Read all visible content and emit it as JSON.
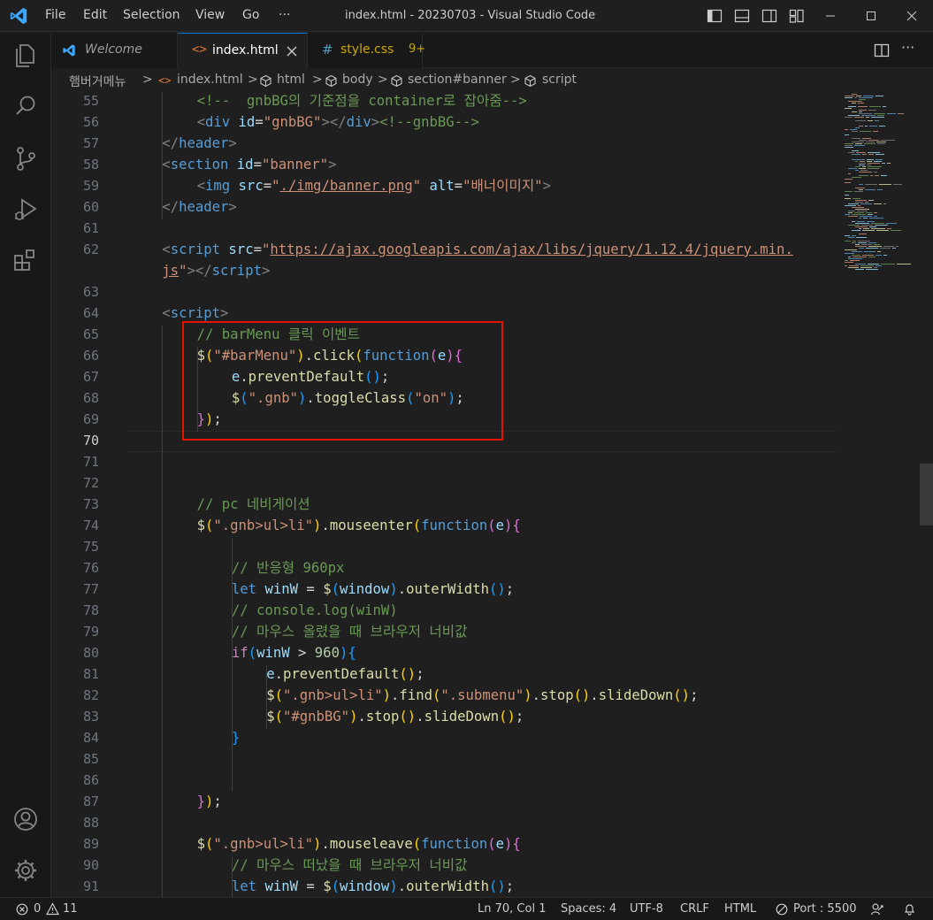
{
  "titlebar": {
    "menus": [
      "File",
      "Edit",
      "Selection",
      "View",
      "Go",
      "···"
    ],
    "title": "index.html - 20230703 - Visual Studio Code"
  },
  "tabs": [
    {
      "label": "Welcome",
      "icon": "vscode-icon"
    },
    {
      "label": "index.html",
      "icon": "html-icon",
      "active": true
    },
    {
      "label": "style.css",
      "badge": "9+",
      "icon": "css-icon"
    }
  ],
  "breadcrumb": {
    "items": [
      "햄버거메뉴",
      "index.html",
      "html",
      "body",
      "section#banner",
      "script"
    ],
    "separator": ">"
  },
  "editor": {
    "current_line": "70",
    "lines": [
      {
        "n": "55",
        "indent": 2,
        "segs": [
          [
            "t-com",
            "<!--  gnbBG의 기준점을 container로 잡아줌-->"
          ]
        ]
      },
      {
        "n": "56",
        "indent": 2,
        "segs": [
          [
            "t-br",
            "<"
          ],
          [
            "t-tag",
            "div"
          ],
          [
            "",
            " "
          ],
          [
            "t-attr",
            "id"
          ],
          [
            "",
            "="
          ],
          [
            "t-str",
            "\"gnbBG\""
          ],
          [
            "t-br",
            "></"
          ],
          [
            "t-tag",
            "div"
          ],
          [
            "t-br",
            ">"
          ],
          [
            "t-com",
            "<!--gnbBG-->"
          ]
        ]
      },
      {
        "n": "57",
        "indent": 1,
        "segs": [
          [
            "t-br",
            "</"
          ],
          [
            "t-tag",
            "header"
          ],
          [
            "t-br",
            ">"
          ]
        ]
      },
      {
        "n": "58",
        "indent": 1,
        "segs": [
          [
            "t-br",
            "<"
          ],
          [
            "t-tag",
            "section"
          ],
          [
            "",
            " "
          ],
          [
            "t-attr",
            "id"
          ],
          [
            "",
            "="
          ],
          [
            "t-str",
            "\"banner\""
          ],
          [
            "t-br",
            ">"
          ]
        ]
      },
      {
        "n": "59",
        "indent": 2,
        "segs": [
          [
            "t-br",
            "<"
          ],
          [
            "t-tag",
            "img"
          ],
          [
            "",
            " "
          ],
          [
            "t-attr",
            "src"
          ],
          [
            "",
            "="
          ],
          [
            "t-str",
            "\""
          ],
          [
            "t-link",
            "./img/banner.png"
          ],
          [
            "t-str",
            "\""
          ],
          [
            "",
            " "
          ],
          [
            "t-attr",
            "alt"
          ],
          [
            "",
            "="
          ],
          [
            "t-str",
            "\"배너이미지\""
          ],
          [
            "t-br",
            ">"
          ]
        ]
      },
      {
        "n": "60",
        "indent": 1,
        "segs": [
          [
            "t-br",
            "</"
          ],
          [
            "t-tag",
            "header"
          ],
          [
            "t-br",
            ">"
          ]
        ]
      },
      {
        "n": "61",
        "indent": 0,
        "segs": []
      },
      {
        "n": "62",
        "indent": 1,
        "segs": [
          [
            "t-br",
            "<"
          ],
          [
            "t-tag",
            "script"
          ],
          [
            "",
            " "
          ],
          [
            "t-attr",
            "src"
          ],
          [
            "",
            "="
          ],
          [
            "t-str",
            "\""
          ],
          [
            "t-link",
            "https://ajax.googleapis.com/ajax/libs/jquery/1.12.4/jquery.min."
          ]
        ]
      },
      {
        "n": "",
        "indent": 1,
        "segs": [
          [
            "t-link",
            "js"
          ],
          [
            "t-str",
            "\""
          ],
          [
            "t-br",
            "></"
          ],
          [
            "t-tag",
            "script"
          ],
          [
            "t-br",
            ">"
          ]
        ]
      },
      {
        "n": "63",
        "indent": 0,
        "segs": []
      },
      {
        "n": "64",
        "indent": 1,
        "segs": [
          [
            "t-br",
            "<"
          ],
          [
            "t-tag",
            "script"
          ],
          [
            "t-br",
            ">"
          ]
        ]
      },
      {
        "n": "65",
        "indent": 2,
        "segs": [
          [
            "t-com",
            "// barMenu 클릭 이벤트"
          ]
        ]
      },
      {
        "n": "66",
        "indent": 2,
        "segs": [
          [
            "t-fn",
            "$"
          ],
          [
            "t-p1",
            "("
          ],
          [
            "t-str",
            "\"#barMenu\""
          ],
          [
            "t-p1",
            ")"
          ],
          [
            "",
            "."
          ],
          [
            "t-fn",
            "click"
          ],
          [
            "t-p1",
            "("
          ],
          [
            "t-kw",
            "function"
          ],
          [
            "t-p2",
            "("
          ],
          [
            "t-var",
            "e"
          ],
          [
            "t-p2",
            ")"
          ],
          [
            "t-p2",
            "{"
          ]
        ]
      },
      {
        "n": "67",
        "indent": 3,
        "segs": [
          [
            "t-var",
            "e"
          ],
          [
            "",
            "."
          ],
          [
            "t-fn",
            "preventDefault"
          ],
          [
            "t-p3",
            "()"
          ],
          [
            ";",
            ";"
          ]
        ]
      },
      {
        "n": "68",
        "indent": 3,
        "segs": [
          [
            "t-fn",
            "$"
          ],
          [
            "t-p3",
            "("
          ],
          [
            "t-str",
            "\".gnb\""
          ],
          [
            "t-p3",
            ")"
          ],
          [
            "",
            "."
          ],
          [
            "t-fn",
            "toggleClass"
          ],
          [
            "t-p3",
            "("
          ],
          [
            "t-str",
            "\"on\""
          ],
          [
            "t-p3",
            ")"
          ],
          [
            "",
            ";"
          ]
        ]
      },
      {
        "n": "69",
        "indent": 2,
        "segs": [
          [
            "t-p2",
            "}"
          ],
          [
            "t-p1",
            ")"
          ],
          [
            "",
            ";"
          ]
        ]
      },
      {
        "n": "70",
        "indent": 0,
        "segs": []
      },
      {
        "n": "71",
        "indent": 0,
        "segs": []
      },
      {
        "n": "72",
        "indent": 0,
        "segs": []
      },
      {
        "n": "73",
        "indent": 2,
        "segs": [
          [
            "t-com",
            "// pc 네비게이션"
          ]
        ]
      },
      {
        "n": "74",
        "indent": 2,
        "segs": [
          [
            "t-fn",
            "$"
          ],
          [
            "t-p1",
            "("
          ],
          [
            "t-str",
            "\".gnb>ul>li\""
          ],
          [
            "t-p1",
            ")"
          ],
          [
            "",
            "."
          ],
          [
            "t-fn",
            "mouseenter"
          ],
          [
            "t-p1",
            "("
          ],
          [
            "t-kw",
            "function"
          ],
          [
            "t-p2",
            "("
          ],
          [
            "t-var",
            "e"
          ],
          [
            "t-p2",
            ")"
          ],
          [
            "t-p2",
            "{"
          ]
        ]
      },
      {
        "n": "75",
        "indent": 0,
        "segs": []
      },
      {
        "n": "76",
        "indent": 3,
        "segs": [
          [
            "t-com",
            "// 반응형 960px"
          ]
        ]
      },
      {
        "n": "77",
        "indent": 3,
        "segs": [
          [
            "t-kw",
            "let"
          ],
          [
            "",
            " "
          ],
          [
            "t-var",
            "winW"
          ],
          [
            "",
            " = "
          ],
          [
            "t-fn",
            "$"
          ],
          [
            "t-p3",
            "("
          ],
          [
            "t-var",
            "window"
          ],
          [
            "t-p3",
            ")"
          ],
          [
            "",
            "."
          ],
          [
            "t-fn",
            "outerWidth"
          ],
          [
            "t-p3",
            "()"
          ],
          [
            "",
            ";"
          ]
        ]
      },
      {
        "n": "78",
        "indent": 3,
        "segs": [
          [
            "t-com",
            "// console.log(winW)"
          ]
        ]
      },
      {
        "n": "79",
        "indent": 3,
        "segs": [
          [
            "t-com",
            "// 마우스 올렸을 때 브라우저 너비값"
          ]
        ]
      },
      {
        "n": "80",
        "indent": 3,
        "segs": [
          [
            "t-ctrl",
            "if"
          ],
          [
            "t-p3",
            "("
          ],
          [
            "t-var",
            "winW"
          ],
          [
            "",
            " > "
          ],
          [
            "t-num",
            "960"
          ],
          [
            "t-p3",
            ")"
          ],
          [
            "t-p3",
            "{"
          ]
        ]
      },
      {
        "n": "81",
        "indent": 4,
        "segs": [
          [
            "t-var",
            "e"
          ],
          [
            "",
            "."
          ],
          [
            "t-fn",
            "preventDefault"
          ],
          [
            "t-p1",
            "()"
          ],
          [
            "",
            ";"
          ]
        ]
      },
      {
        "n": "82",
        "indent": 4,
        "segs": [
          [
            "t-fn",
            "$"
          ],
          [
            "t-p1",
            "("
          ],
          [
            "t-str",
            "\".gnb>ul>li\""
          ],
          [
            "t-p1",
            ")"
          ],
          [
            "",
            "."
          ],
          [
            "t-fn",
            "find"
          ],
          [
            "t-p1",
            "("
          ],
          [
            "t-str",
            "\".submenu\""
          ],
          [
            "t-p1",
            ")"
          ],
          [
            "",
            "."
          ],
          [
            "t-fn",
            "stop"
          ],
          [
            "t-p1",
            "()"
          ],
          [
            "",
            "."
          ],
          [
            "t-fn",
            "slideDown"
          ],
          [
            "t-p1",
            "()"
          ],
          [
            "",
            ";"
          ]
        ]
      },
      {
        "n": "83",
        "indent": 4,
        "segs": [
          [
            "t-fn",
            "$"
          ],
          [
            "t-p1",
            "("
          ],
          [
            "t-str",
            "\"#gnbBG\""
          ],
          [
            "t-p1",
            ")"
          ],
          [
            "",
            "."
          ],
          [
            "t-fn",
            "stop"
          ],
          [
            "t-p1",
            "()"
          ],
          [
            "",
            "."
          ],
          [
            "t-fn",
            "slideDown"
          ],
          [
            "t-p1",
            "()"
          ],
          [
            "",
            ";"
          ]
        ]
      },
      {
        "n": "84",
        "indent": 3,
        "segs": [
          [
            "t-p3",
            "}"
          ]
        ]
      },
      {
        "n": "85",
        "indent": 0,
        "segs": []
      },
      {
        "n": "86",
        "indent": 0,
        "segs": []
      },
      {
        "n": "87",
        "indent": 2,
        "segs": [
          [
            "t-p2",
            "}"
          ],
          [
            "t-p1",
            ")"
          ],
          [
            "",
            ";"
          ]
        ]
      },
      {
        "n": "88",
        "indent": 0,
        "segs": []
      },
      {
        "n": "89",
        "indent": 2,
        "segs": [
          [
            "t-fn",
            "$"
          ],
          [
            "t-p1",
            "("
          ],
          [
            "t-str",
            "\".gnb>ul>li\""
          ],
          [
            "t-p1",
            ")"
          ],
          [
            "",
            "."
          ],
          [
            "t-fn",
            "mouseleave"
          ],
          [
            "t-p1",
            "("
          ],
          [
            "t-kw",
            "function"
          ],
          [
            "t-p2",
            "("
          ],
          [
            "t-var",
            "e"
          ],
          [
            "t-p2",
            ")"
          ],
          [
            "t-p2",
            "{"
          ]
        ]
      },
      {
        "n": "90",
        "indent": 3,
        "segs": [
          [
            "t-com",
            "// 마우스 떠났을 때 브라우저 너비값"
          ]
        ]
      },
      {
        "n": "91",
        "indent": 3,
        "segs": [
          [
            "t-kw",
            "let"
          ],
          [
            "",
            " "
          ],
          [
            "t-var",
            "winW"
          ],
          [
            "",
            " = "
          ],
          [
            "t-fn",
            "$"
          ],
          [
            "t-p3",
            "("
          ],
          [
            "t-var",
            "window"
          ],
          [
            "t-p3",
            ")"
          ],
          [
            "",
            "."
          ],
          [
            "t-fn",
            "outerWidth"
          ],
          [
            "t-p3",
            "()"
          ],
          [
            "",
            ";"
          ]
        ]
      }
    ]
  },
  "statusbar": {
    "errors": "0",
    "warnings": "11",
    "position": "Ln 70, Col 1",
    "spaces": "Spaces: 4",
    "encoding": "UTF-8",
    "eol": "CRLF",
    "language": "HTML",
    "port": "Port : 5500"
  },
  "colors": {
    "accent": "#0078d4",
    "highlight_box": "#e51400"
  }
}
